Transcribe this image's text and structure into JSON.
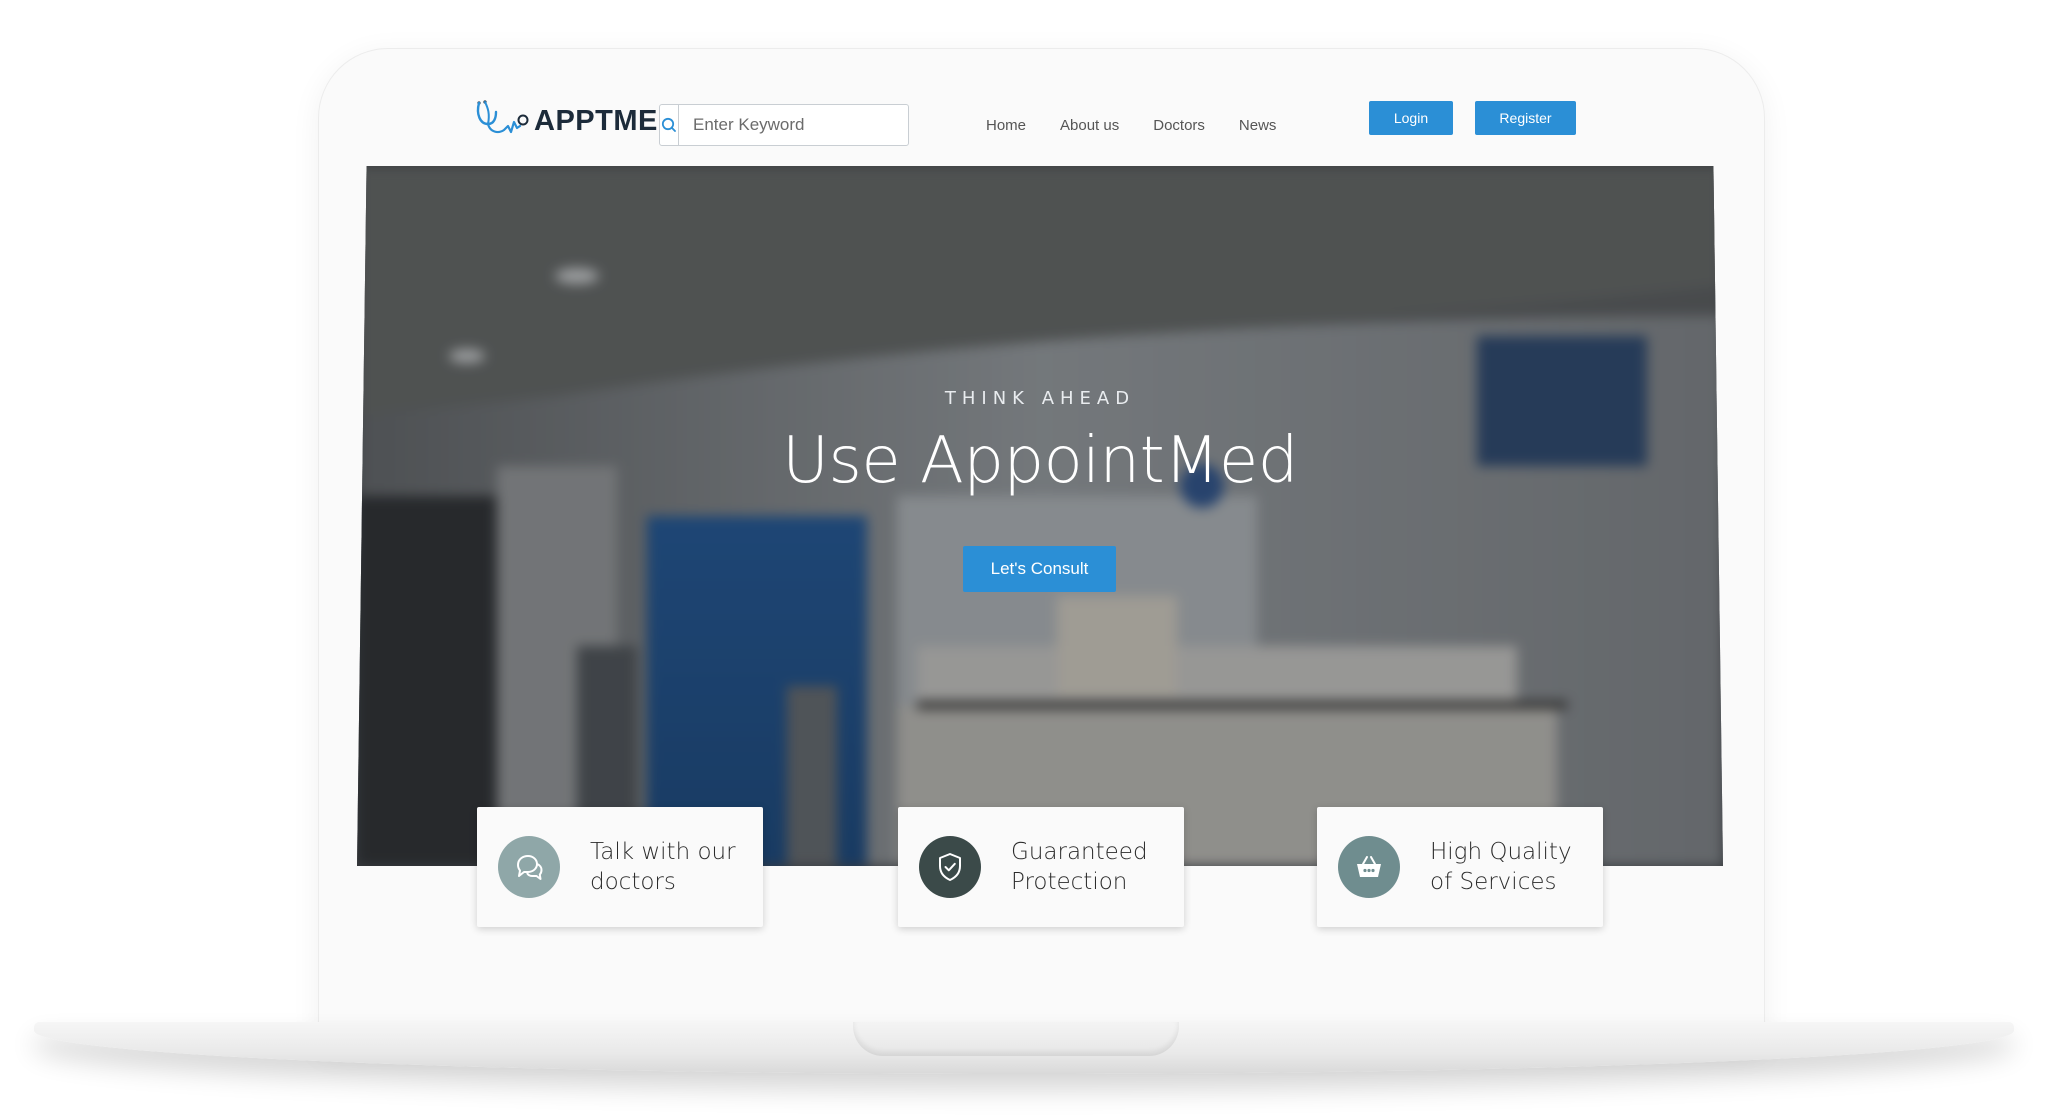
{
  "brand": {
    "logo_text": "APPTMED"
  },
  "search": {
    "placeholder": "Enter Keyword"
  },
  "nav": {
    "items": [
      "Home",
      "About us",
      "Doctors",
      "News"
    ]
  },
  "auth": {
    "login_label": "Login",
    "register_label": "Register"
  },
  "hero": {
    "eyebrow": "THINK AHEAD",
    "title": "Use AppointMed",
    "cta_label": "Let's Consult"
  },
  "features": [
    {
      "label": "Talk with our doctors",
      "icon": "chat-bubbles-icon",
      "icon_bg": "#8fa7a8"
    },
    {
      "label": "Guaranteed Protection",
      "icon": "shield-check-icon",
      "icon_bg": "#3b4a49"
    },
    {
      "label": "High Quality of Services",
      "icon": "basket-icon",
      "icon_bg": "#6f8d8f"
    }
  ],
  "colors": {
    "accent": "#2b8fd6",
    "brand_text": "#1c2b3a"
  }
}
